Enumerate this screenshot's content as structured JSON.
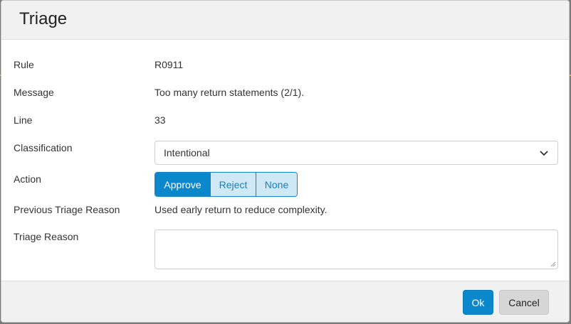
{
  "dialog": {
    "title": "Triage"
  },
  "fields": {
    "rule": {
      "label": "Rule",
      "value": "R0911"
    },
    "message": {
      "label": "Message",
      "value": "Too many return statements (2/1)."
    },
    "line": {
      "label": "Line",
      "value": "33"
    },
    "classification": {
      "label": "Classification",
      "selected": "Intentional"
    },
    "action": {
      "label": "Action",
      "options": [
        "Approve",
        "Reject",
        "None"
      ],
      "selected": "Approve"
    },
    "previous_reason": {
      "label": "Previous Triage Reason",
      "value": "Used early return to reduce complexity."
    },
    "triage_reason": {
      "label": "Triage Reason",
      "value": ""
    }
  },
  "footer": {
    "ok_label": "Ok",
    "cancel_label": "Cancel"
  },
  "colors": {
    "primary": "#0b88cc",
    "segment_inactive": "#cfe8f6",
    "header_bg": "#f1f1f1",
    "cancel_bg": "#d6d6d6"
  },
  "icons": {
    "select_arrow": "chevron-down-icon",
    "textarea_grip": "resize-grip-icon"
  }
}
